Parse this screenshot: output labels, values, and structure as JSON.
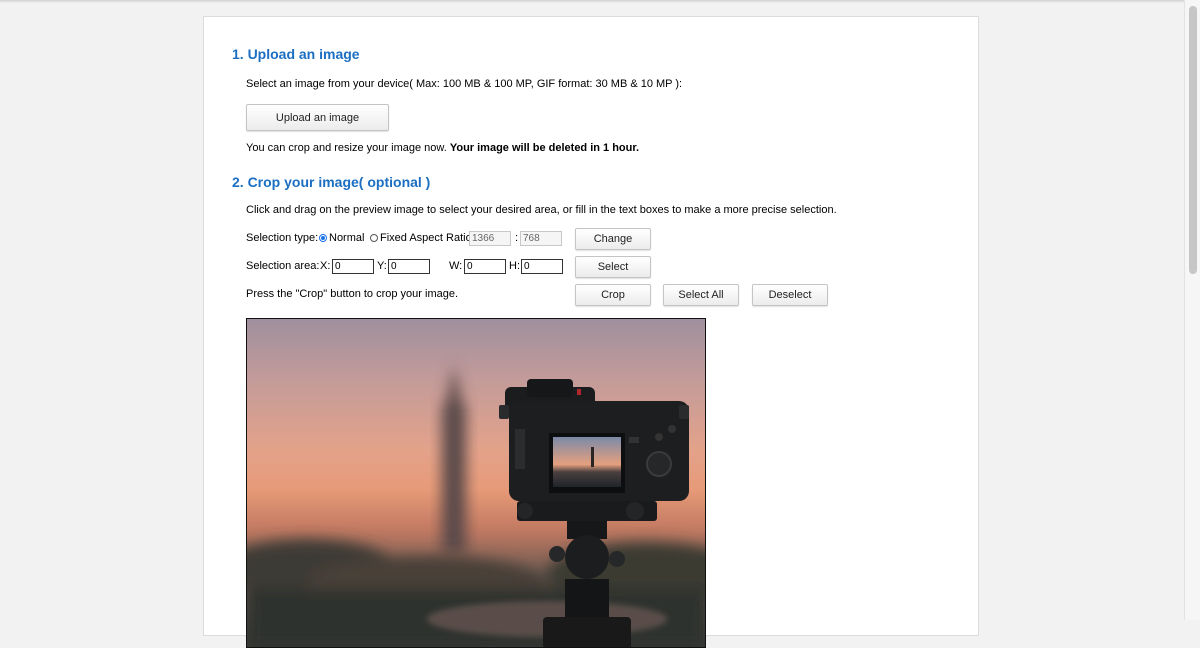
{
  "section1": {
    "heading": "1. Upload an image",
    "instruction": "Select an image from your device( Max: 100 MB & 100 MP, GIF format: 30 MB & 10 MP ):",
    "upload_label": "Upload an image",
    "note_plain": "You can crop and resize your image now. ",
    "note_bold": "Your image will be deleted in 1 hour."
  },
  "section2": {
    "heading": "2. Crop your image( optional )",
    "instruction": "Click and drag on the preview image to select your desired area, or fill in the text boxes to make a more precise selection.",
    "selection_type_label": "Selection type:",
    "normal_label": "Normal",
    "fixed_label": "Fixed Aspect Ratio",
    "ratio_w": "1366",
    "ratio_sep": ":",
    "ratio_h": "768",
    "change_label": "Change",
    "area_label": "Selection area:",
    "x_label": "X:",
    "x_value": "0",
    "y_label": "Y:",
    "y_value": "0",
    "w_label": "W:",
    "w_value": "0",
    "h_label": "H:",
    "h_value": "0",
    "select_label": "Select",
    "crop_note": "Press the \"Crop\" button to crop your image.",
    "crop_label": "Crop",
    "select_all_label": "Select All",
    "deselect_label": "Deselect"
  },
  "colors": {
    "heading": "#1b6ec2",
    "radio_accent": "#1a73e8"
  }
}
